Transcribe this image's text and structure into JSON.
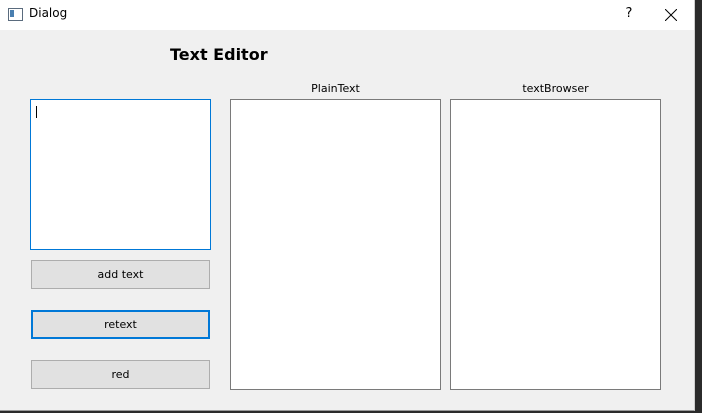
{
  "window": {
    "title": "Dialog",
    "help_label": "?"
  },
  "main": {
    "heading": "Text Editor",
    "plain_text_label": "PlainText",
    "text_browser_label": "textBrowser",
    "text_edit_value": "",
    "plain_text_value": "",
    "text_browser_value": ""
  },
  "buttons": {
    "add_text": "add text",
    "retext": "retext",
    "red": "red"
  },
  "icons": {
    "app": "window-icon",
    "help": "help-icon",
    "close": "close-icon"
  }
}
